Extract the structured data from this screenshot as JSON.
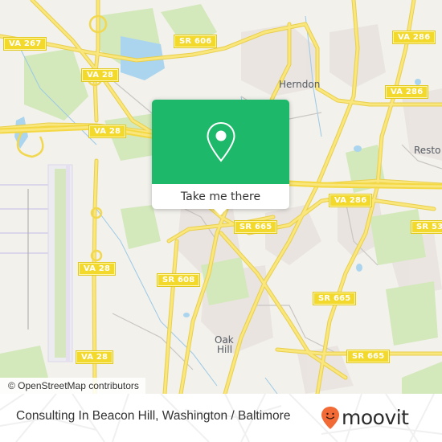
{
  "map": {
    "road_labels": [
      {
        "id": "va-267",
        "text": "VA 267"
      },
      {
        "id": "sr-606",
        "text": "SR 606"
      },
      {
        "id": "va-286-ne",
        "text": "VA 286"
      },
      {
        "id": "va-28-n",
        "text": "VA 28"
      },
      {
        "id": "va-286-e",
        "text": "VA 286"
      },
      {
        "id": "va-28-mid",
        "text": "VA 28"
      },
      {
        "id": "va-286-s",
        "text": "VA 286"
      },
      {
        "id": "sr-665-a",
        "text": "SR 665"
      },
      {
        "id": "sr-53",
        "text": "SR 53"
      },
      {
        "id": "va-28-w",
        "text": "VA 28"
      },
      {
        "id": "sr-608",
        "text": "SR 608"
      },
      {
        "id": "sr-665-b",
        "text": "SR 665"
      },
      {
        "id": "va-28-sw",
        "text": "VA 28"
      },
      {
        "id": "sr-665-c",
        "text": "SR 665"
      }
    ],
    "place_labels": {
      "herndon": "Herndon",
      "reston": "Resto",
      "oak": "Oak",
      "hill": "Hill"
    },
    "colors": {
      "background": "#f2f1ec",
      "road": "#f7e16b",
      "road_edge": "#e9cf4a",
      "park": "#cfe6b4",
      "water": "#a9d3ee",
      "residential": "#e8e2de"
    }
  },
  "popup": {
    "icon": "map-pin-icon",
    "button_label": "Take me there",
    "color": "#1db86a"
  },
  "attribution": "© OpenStreetMap contributors",
  "footer": {
    "title": "Consulting In Beacon Hill, Washington / Baltimore",
    "brand": "moovit",
    "brand_icon": "moovit-pin-icon",
    "brand_color": "#f26a35"
  }
}
